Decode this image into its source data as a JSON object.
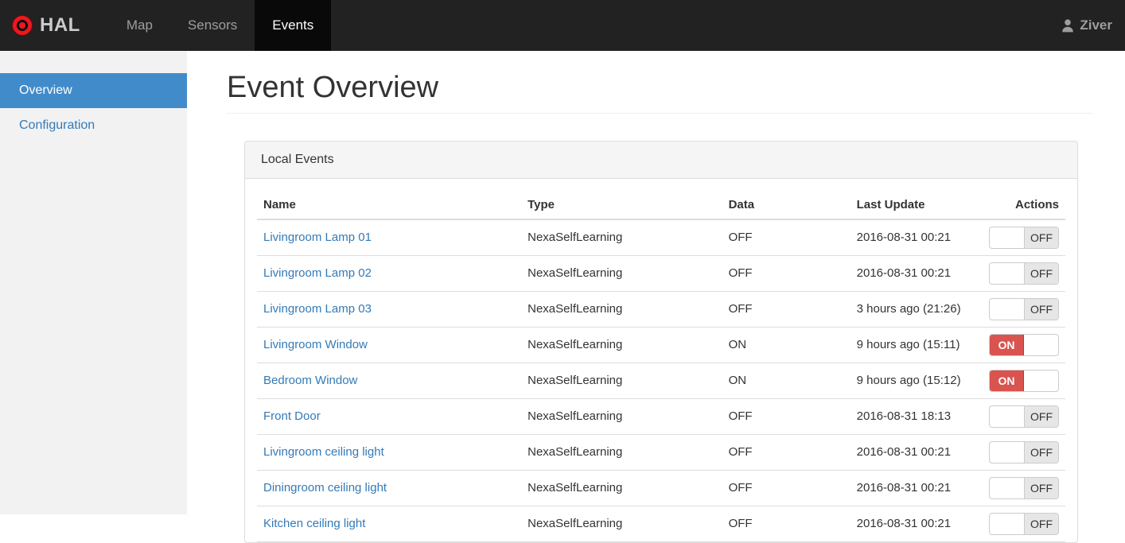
{
  "navbar": {
    "brand": "HAL",
    "items": [
      {
        "label": "Map",
        "active": false
      },
      {
        "label": "Sensors",
        "active": false
      },
      {
        "label": "Events",
        "active": true
      }
    ],
    "user": "Ziver"
  },
  "sidebar": {
    "items": [
      {
        "label": "Overview",
        "active": true
      },
      {
        "label": "Configuration",
        "active": false
      }
    ]
  },
  "main": {
    "title": "Event Overview",
    "panel": {
      "title": "Local Events",
      "table": {
        "columns": [
          "Name",
          "Type",
          "Data",
          "Last Update",
          "Actions"
        ],
        "rows": [
          {
            "name": "Livingroom Lamp 01",
            "type": "NexaSelfLearning",
            "data": "OFF",
            "last_update": "2016-08-31 00:21",
            "state": "OFF"
          },
          {
            "name": "Livingroom Lamp 02",
            "type": "NexaSelfLearning",
            "data": "OFF",
            "last_update": "2016-08-31 00:21",
            "state": "OFF"
          },
          {
            "name": "Livingroom Lamp 03",
            "type": "NexaSelfLearning",
            "data": "OFF",
            "last_update": "3 hours ago (21:26)",
            "state": "OFF"
          },
          {
            "name": "Livingroom Window",
            "type": "NexaSelfLearning",
            "data": "ON",
            "last_update": "9 hours ago (15:11)",
            "state": "ON"
          },
          {
            "name": "Bedroom Window",
            "type": "NexaSelfLearning",
            "data": "ON",
            "last_update": "9 hours ago (15:12)",
            "state": "ON"
          },
          {
            "name": "Front Door",
            "type": "NexaSelfLearning",
            "data": "OFF",
            "last_update": "2016-08-31 18:13",
            "state": "OFF"
          },
          {
            "name": "Livingroom ceiling light",
            "type": "NexaSelfLearning",
            "data": "OFF",
            "last_update": "2016-08-31 00:21",
            "state": "OFF"
          },
          {
            "name": "Diningroom ceiling light",
            "type": "NexaSelfLearning",
            "data": "OFF",
            "last_update": "2016-08-31 00:21",
            "state": "OFF"
          },
          {
            "name": "Kitchen ceiling light",
            "type": "NexaSelfLearning",
            "data": "OFF",
            "last_update": "2016-08-31 00:21",
            "state": "OFF"
          }
        ]
      }
    }
  },
  "colors": {
    "navbar_bg": "#222222",
    "navbar_active_bg": "#090909",
    "nav_link": "#9d9d9d",
    "accent_blue": "#428bca",
    "link_blue": "#337ab7",
    "toggle_on_red": "#d9534f",
    "toggle_off_grey": "#e6e6e6",
    "logo_red": "#e8191f"
  },
  "icons": {
    "logo": "target-icon",
    "user": "person-icon"
  }
}
